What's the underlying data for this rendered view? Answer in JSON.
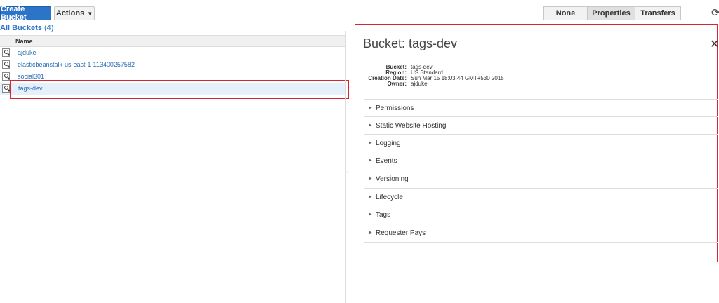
{
  "toolbar": {
    "create_bucket": "Create Bucket",
    "actions": "Actions",
    "views": [
      "None",
      "Properties",
      "Transfers"
    ],
    "active_view": "Properties"
  },
  "buckets": {
    "heading": "All Buckets",
    "count": "(4)",
    "column_name": "Name",
    "items": [
      {
        "name": "ajduke"
      },
      {
        "name": "elasticbeanstalk-us-east-1-113400257582"
      },
      {
        "name": "social301"
      },
      {
        "name": "tags-dev"
      }
    ],
    "selected": "tags-dev"
  },
  "panel": {
    "title": "Bucket: tags-dev",
    "meta_keys": [
      "Bucket:",
      "Region:",
      "Creation Date:",
      "Owner:"
    ],
    "meta_values": [
      "tags-dev",
      "US Standard",
      "Sun Mar 15 18:03:44 GMT+530 2015",
      "ajduke"
    ],
    "sections": [
      "Permissions",
      "Static Website Hosting",
      "Logging",
      "Events",
      "Versioning",
      "Lifecycle",
      "Tags",
      "Requester Pays"
    ]
  },
  "colors": {
    "accent": "#2c74c8",
    "highlight_border": "#d9262e",
    "selected_row": "#e6f0fa"
  }
}
